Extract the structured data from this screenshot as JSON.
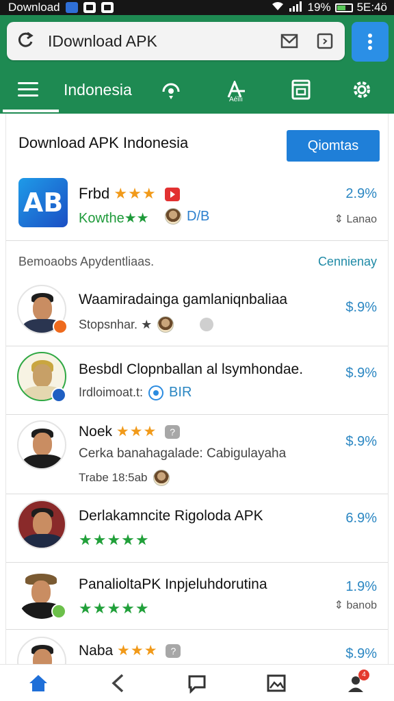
{
  "status_bar": {
    "app_name": "Download",
    "battery": "19%",
    "time": "5E:4ö"
  },
  "browser": {
    "url_text": "IDownload APK"
  },
  "tab_nav": {
    "title": "Indonesia",
    "translate_label": "Aéǐıı"
  },
  "header": {
    "title": "Download APK Indonesia",
    "cta_label": "Qiomtas"
  },
  "featured": {
    "name": "Frbd",
    "stars": "★★★",
    "subtitle": "Kowthe★★",
    "developer": "D/B",
    "percent": "2.9%",
    "size": "⇕ Lanao",
    "logo_text": "AB"
  },
  "section": {
    "label": "Bemoaobs Apydentliaas.",
    "link": "Cennienay"
  },
  "items": [
    {
      "title": "Waamiradainga gamlaniqnbaliaa",
      "subtitle": "Stopsnhar. ★",
      "percent": "$.9%"
    },
    {
      "title": "Besbdl Clopnballan al lsymhondae.",
      "subtitle": "Irdloimoat.t:",
      "developer": "BIR",
      "percent": "$.9%"
    },
    {
      "title": "Noek",
      "stars": "★★★",
      "subtitle": "Cerka banahagalade: Cabigulayaha",
      "subtitle2": "Trabe 18:5ab",
      "percent": "$.9%"
    },
    {
      "title": "Derlakamncite Rigoloda APK",
      "stars": "★★★★★",
      "percent": "6.9%"
    },
    {
      "title": "PanalioltaPK Inpjeluhdorutina",
      "stars": "★★★★★",
      "percent": "1.9%",
      "size": "⇕ banob"
    },
    {
      "title": "Naba",
      "stars": "★★★",
      "percent": "$.9%"
    }
  ],
  "bottom_nav": {
    "notification_count": "4"
  },
  "colors": {
    "primary_green": "#1e8a52",
    "accent_blue": "#1f7fd8",
    "star_orange": "#f19a1a",
    "star_green": "#21a03a"
  }
}
